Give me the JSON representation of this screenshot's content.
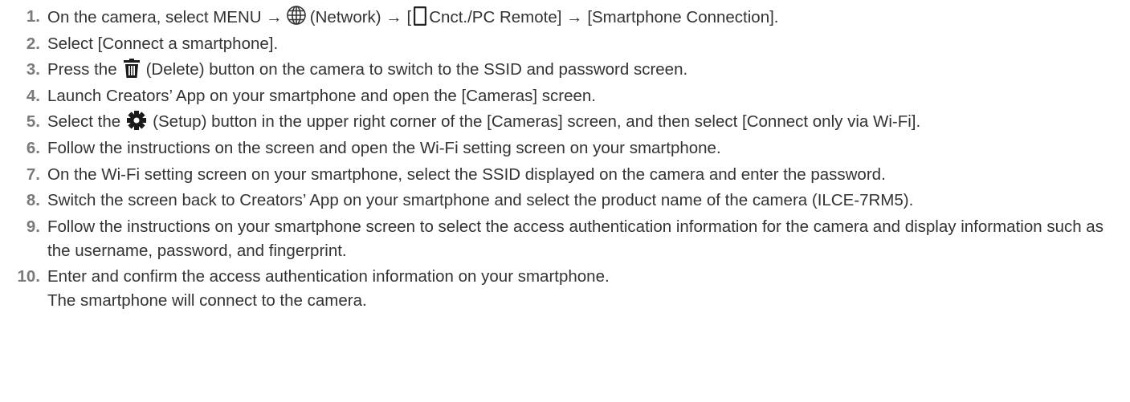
{
  "steps": [
    {
      "number": "1.",
      "parts": {
        "a": "On the camera, select MENU →",
        "icon1": "globe-network-icon",
        "b": "(Network) → [",
        "icon2": "smartphone-icon",
        "c": "Cnct./PC Remote] → [Smartphone Connection]."
      }
    },
    {
      "number": "2.",
      "text": "Select [Connect a smartphone]."
    },
    {
      "number": "3.",
      "parts": {
        "a": "Press the",
        "icon1": "trash-delete-icon",
        "b": "(Delete) button on the camera to switch to the SSID and password screen."
      }
    },
    {
      "number": "4.",
      "text": "Launch Creators’ App on your smartphone and open the [Cameras] screen."
    },
    {
      "number": "5.",
      "parts": {
        "a": "Select the",
        "icon1": "gear-setup-icon",
        "b": "(Setup) button in the upper right corner of the [Cameras] screen, and then select [Connect only via Wi-Fi]."
      }
    },
    {
      "number": "6.",
      "text": "Follow the instructions on the screen and open the Wi-Fi setting screen on your smartphone."
    },
    {
      "number": "7.",
      "text": "On the Wi-Fi setting screen on your smartphone, select the SSID displayed on the camera and enter the password."
    },
    {
      "number": "8.",
      "text": "Switch the screen back to Creators’ App on your smartphone and select the product name of the camera (ILCE-7RM5)."
    },
    {
      "number": "9.",
      "text": "Follow the instructions on your smartphone screen to select the access authentication information for the camera and display information such as the username, password, and fingerprint."
    },
    {
      "number": "10.",
      "text": "Enter and confirm the access authentication information on your smartphone.",
      "note": "The smartphone will connect to the camera."
    }
  ]
}
